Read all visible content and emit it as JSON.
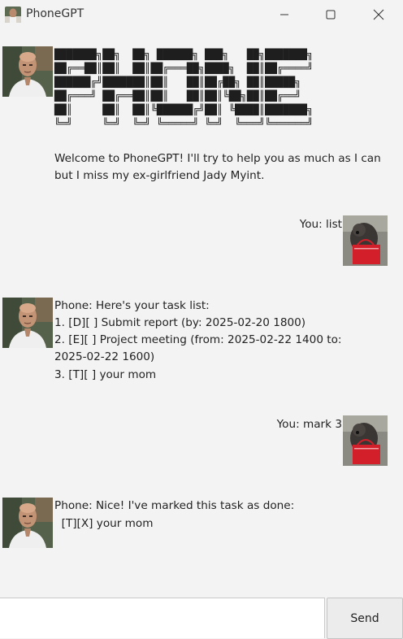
{
  "window": {
    "title": "PhoneGPT"
  },
  "messages": [
    {
      "sender": "bot",
      "banner": [
        "███████╗██╗  ██╗ ██████╗ ███╗   ██╗███████╗",
        "██╔══██║██║  ██║██╔═══██╗████╗  ██║██╔════╝",
        "██████╔╝███████║██║   ██║██╔██╗ ██║█████╗  ",
        "██╔═══╝ ██╔══██║██║   ██║██║╚██╗██║██╔══╝  ",
        "██║     ██║  ██║╚██████╔╝██║ ╚████║███████╗",
        "╚═╝     ╚═╝  ╚═╝ ╚═════╝ ╚═╝  ╚═══╝╚══════╝"
      ],
      "lines": [
        "Welcome to PhoneGPT! I'll try to help you as much as I can",
        "but I miss my ex-girlfriend Jady Myint."
      ]
    },
    {
      "sender": "user",
      "text": "You: list"
    },
    {
      "sender": "bot",
      "lines": [
        "Phone: Here's your task list:",
        "1. [D][ ] Submit report (by: 2025-02-20 1800)",
        "2. [E][ ] Project meeting (from: 2025-02-22 1400 to:",
        "2025-02-22 1600)",
        "3. [T][ ] your mom"
      ]
    },
    {
      "sender": "user",
      "text": "You: mark 3"
    },
    {
      "sender": "bot",
      "lines": [
        "Phone: Nice! I've marked this task as done:",
        "  [T][X] your mom"
      ]
    }
  ],
  "input": {
    "value": ""
  },
  "send_button": {
    "label": "Send"
  }
}
